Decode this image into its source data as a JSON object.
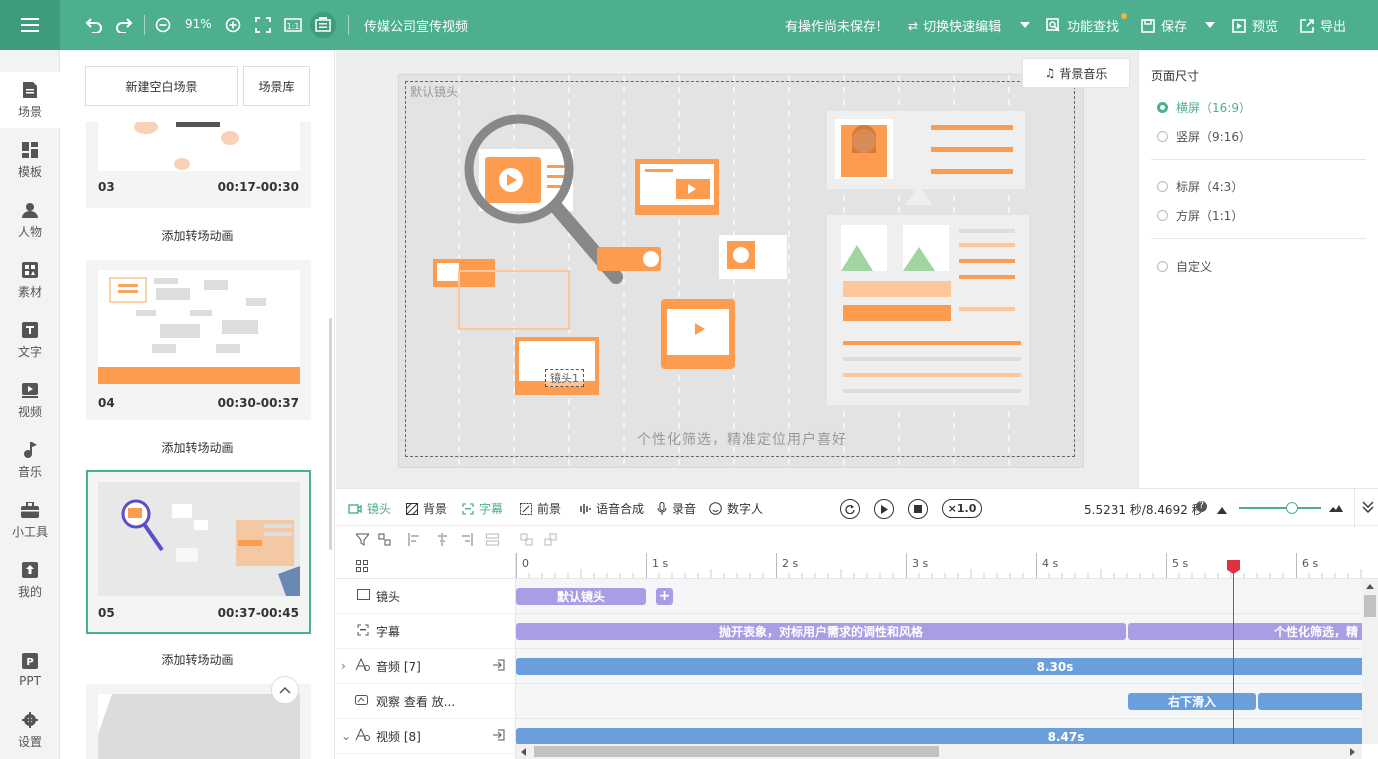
{
  "topbar": {
    "zoom": "91%",
    "project_title": "传媒公司宣传视频",
    "unsaved_notice": "有操作尚未保存!",
    "switch_edit": "切换快速编辑",
    "feature_search": "功能查找",
    "save": "保存",
    "preview": "预览",
    "export": "导出"
  },
  "nav": [
    {
      "label": "场景",
      "icon": "scene-icon"
    },
    {
      "label": "模板",
      "icon": "template-icon"
    },
    {
      "label": "人物",
      "icon": "person-icon"
    },
    {
      "label": "素材",
      "icon": "material-icon"
    },
    {
      "label": "文字",
      "icon": "text-icon"
    },
    {
      "label": "视频",
      "icon": "video-icon"
    },
    {
      "label": "音乐",
      "icon": "music-icon"
    },
    {
      "label": "小工具",
      "icon": "toolbox-icon"
    },
    {
      "label": "我的",
      "icon": "upload-icon"
    },
    {
      "label": "PPT",
      "icon": "ppt-icon"
    },
    {
      "label": "设置",
      "icon": "gear-icon"
    }
  ],
  "scene_panel": {
    "new_blank": "新建空白场景",
    "library": "场景库",
    "add_transition": "添加转场动画",
    "scenes": [
      {
        "num": "03",
        "time": "00:17-00:30"
      },
      {
        "num": "04",
        "time": "00:30-00:37"
      },
      {
        "num": "05",
        "time": "00:37-00:45"
      }
    ]
  },
  "canvas": {
    "bg_music": "背景音乐",
    "camera_label": "默认镜头",
    "camera_1": "镜头1",
    "subtitle": "个性化筛选，精准定位用户喜好"
  },
  "page_size": {
    "title": "页面尺寸",
    "options": [
      "横屏（16:9）",
      "竖屏（9:16）",
      "标屏（4:3）",
      "方屏（1:1）",
      "自定义"
    ],
    "selected": 0
  },
  "timeline": {
    "tabs": [
      "镜头",
      "背景",
      "字幕",
      "前景",
      "语音合成",
      "录音",
      "数字人"
    ],
    "speed": "×1.0",
    "time": "5.5231 秒/8.4692 秒",
    "ruler": [
      "0",
      "1 s",
      "2 s",
      "3 s",
      "4 s",
      "5 s",
      "6 s"
    ],
    "tracks": [
      "镜头",
      "字幕",
      "音频 [7]",
      "观察 查看 放...",
      "视频 [8]"
    ],
    "clips": {
      "camera": "默认镜头",
      "caption_1": "抛开表象，对标用户需求的调性和风格",
      "caption_2": "个性化筛选，精",
      "audio": "8.30s",
      "effect": "右下滑入",
      "video": "8.47s"
    }
  }
}
